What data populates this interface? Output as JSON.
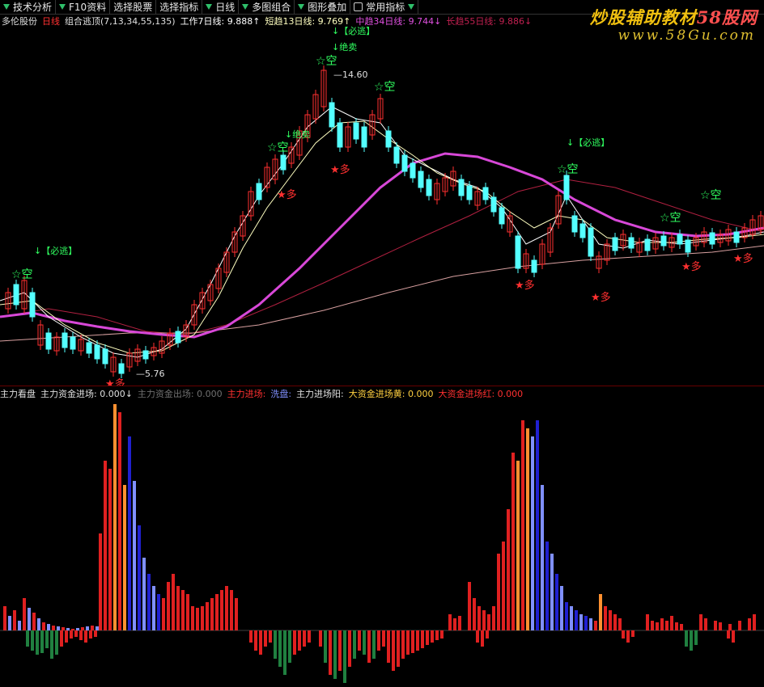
{
  "toolbar": {
    "items": [
      {
        "label": "技术分析"
      },
      {
        "label": "F10资料"
      },
      {
        "label": "选择股票"
      },
      {
        "label": "选择指标"
      },
      {
        "label": "日线"
      },
      {
        "label": "多图组合"
      },
      {
        "label": "图形叠加"
      },
      {
        "label": "常用指标"
      }
    ]
  },
  "header": {
    "stock": "多伦股份",
    "period": "日线",
    "indicator": "组合逃顶(7,13,34,55,135)",
    "ma7": "工作7日线: 9.888↑",
    "ma13": "短趋13日线: 9.769↑",
    "ma34": "中趋34日线: 9.744↓",
    "ma55": "长趋55日线: 9.886↓"
  },
  "watermark": {
    "line1": "炒股辅助教材",
    "line1b": "58股网",
    "line2": "www.58Gu.com"
  },
  "indicator_header": {
    "name": "主力看盘",
    "f1": "主力资金进场: 0.000↓",
    "f2": "主力资金出场: 0.000",
    "f3": "主力进场:",
    "f4": "洗盘:",
    "f5": "主力进场阳:",
    "f6": "大资金进场黄: 0.000",
    "f7": "大资金进场红: 0.000"
  },
  "annotations": {
    "high_price": "14.60",
    "low_price": "5.76",
    "sell_must": "【必逃】",
    "sell_absolute": "绝卖",
    "short": "空",
    "long": "多"
  },
  "colors": {
    "up": "#ff3030",
    "down": "#54ffff",
    "ma7": "#ffffff",
    "ma13": "#ffffc0",
    "ma34": "#e050e0",
    "ma55": "#b02040",
    "ma135": "#d8a0a0",
    "bar_red": "#e02020",
    "bar_orange": "#ff9030",
    "bar_blue": "#2020d0",
    "bar_lightblue": "#8090ff",
    "bar_green": "#208040",
    "bar_pink": "#ff80ff"
  }
}
